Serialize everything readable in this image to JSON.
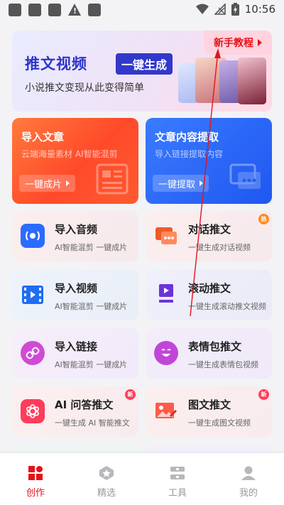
{
  "status_bar": {
    "time": "10:56",
    "icons": [
      "notification-square-icon",
      "notification-square-icon",
      "notification-square-icon",
      "warning-icon",
      "notification-square-icon",
      "wifi-icon",
      "signal-off-icon",
      "battery-charging-icon"
    ]
  },
  "banner": {
    "title": "推文视频",
    "badge": "一键生成",
    "subtitle": "小说推文变现从此变得简单",
    "tutorial_label": "新手教程"
  },
  "big_cards": [
    {
      "title": "导入文章",
      "subtitle": "云端海量素材 AI智能混剪",
      "button": "一键成片",
      "icon": "document-icon"
    },
    {
      "title": "文章内容提取",
      "subtitle": "导入链接提取内容",
      "button": "一键提取",
      "icon": "chat-bubble-icon"
    }
  ],
  "tiles": [
    {
      "title": "导入音频",
      "subtitle": "AI智能混剪 一键成片",
      "icon": "audio-icon"
    },
    {
      "title": "对话推文",
      "subtitle": "一键生成对话视频",
      "icon": "dialog-icon",
      "badge": "热"
    },
    {
      "title": "导入视频",
      "subtitle": "AI智能混剪 一键成片",
      "icon": "film-icon"
    },
    {
      "title": "滚动推文",
      "subtitle": "一键生成滚动推文视频",
      "icon": "scroll-play-icon"
    },
    {
      "title": "导入链接",
      "subtitle": "AI智能混剪 一键成片",
      "icon": "link-icon"
    },
    {
      "title": "表情包推文",
      "subtitle": "一键生成表情包视频",
      "icon": "emoji-icon"
    },
    {
      "title": "AI 问答推文",
      "subtitle": "一键生成 AI 智能推文",
      "icon": "ai-logo-icon",
      "badge": "新"
    },
    {
      "title": "图文推文",
      "subtitle": "一键生成图文视频",
      "icon": "image-icon",
      "badge": "新"
    }
  ],
  "bottom_nav": [
    {
      "label": "创作",
      "icon": "create-grid-icon",
      "active": true
    },
    {
      "label": "精选",
      "icon": "star-icon",
      "active": false
    },
    {
      "label": "工具",
      "icon": "tools-icon",
      "active": false
    },
    {
      "label": "我的",
      "icon": "person-icon",
      "active": false
    }
  ],
  "colors": {
    "accent": "#e4131b",
    "banner_blue": "#2f35c8",
    "orange_card": "#ff5a30",
    "blue_card": "#1f57f0",
    "annotation_arrow": "#e4131b"
  }
}
